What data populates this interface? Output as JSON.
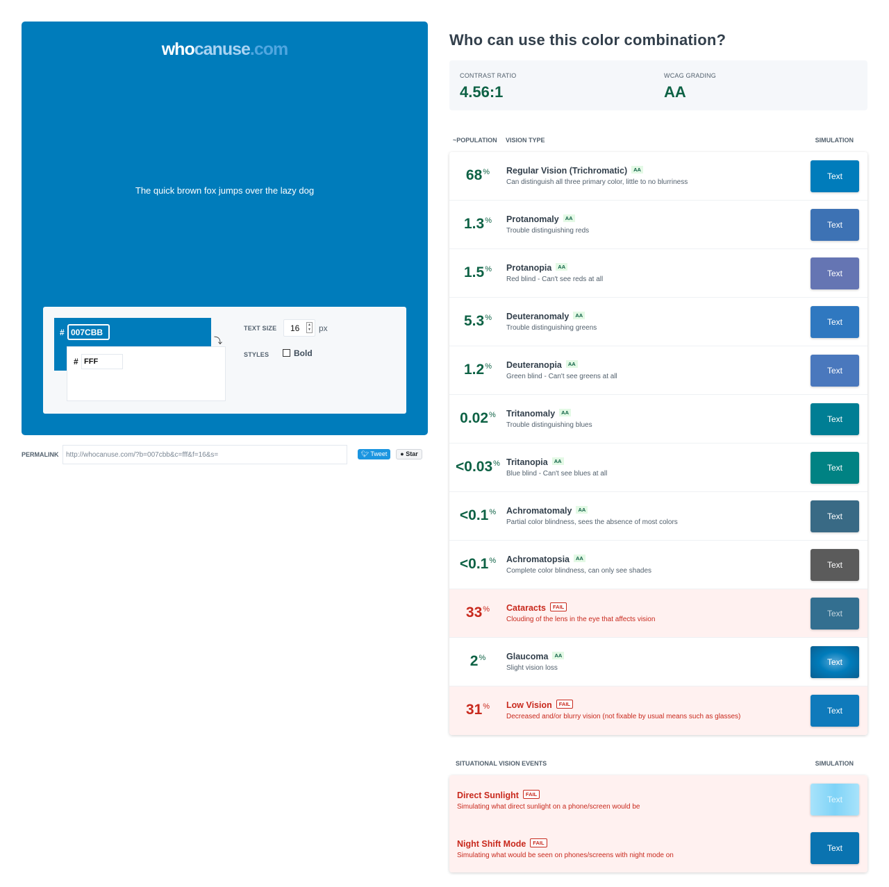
{
  "logo": {
    "who": "who",
    "canuse": "canuse",
    "dotcom": ".com"
  },
  "preview": {
    "sample_text": "The quick brown fox jumps over the lazy dog",
    "background": "#007CBB",
    "foreground": "#FFFFFF"
  },
  "controls": {
    "bg_hash": "#",
    "bg_value": "007CBB",
    "fg_hash": "#",
    "fg_value": "FFF",
    "swap_icon": "⤵",
    "text_size_label": "TEXT SIZE",
    "text_size_value": "16",
    "text_size_unit": "px",
    "styles_label": "STYLES",
    "bold_label": "Bold"
  },
  "permalink": {
    "label": "PERMALINK",
    "value": "http://whocanuse.com/?b=007cbb&c=fff&f=16&s=",
    "tweet_label": "Tweet",
    "star_label": "Star"
  },
  "results": {
    "title": "Who can use this color combination?",
    "contrast_label": "CONTRAST RATIO",
    "contrast_value": "4.56:1",
    "wcag_label": "WCAG GRADING",
    "wcag_value": "AA",
    "col_population": "~POPULATION",
    "col_vision": "VISION TYPE",
    "col_simulation": "SIMULATION",
    "rows": [
      {
        "pct": "68",
        "name": "Regular Vision (Trichromatic)",
        "badge": "AA",
        "desc": "Can distinguish all three primary color, little to no blurriness",
        "sim": "Text",
        "status": "pass",
        "sim_bg": "#007cbb"
      },
      {
        "pct": "1.3",
        "name": "Protanomaly",
        "badge": "AA",
        "desc": "Trouble distinguishing reds",
        "sim": "Text",
        "status": "pass",
        "sim_bg": "#3d72b4"
      },
      {
        "pct": "1.5",
        "name": "Protanopia",
        "badge": "AA",
        "desc": "Red blind - Can't see reds at all",
        "sim": "Text",
        "status": "pass",
        "sim_bg": "#6575b3"
      },
      {
        "pct": "5.3",
        "name": "Deuteranomaly",
        "badge": "AA",
        "desc": "Trouble distinguishing greens",
        "sim": "Text",
        "status": "pass",
        "sim_bg": "#2f78c0"
      },
      {
        "pct": "1.2",
        "name": "Deuteranopia",
        "badge": "AA",
        "desc": "Green blind - Can't see greens at all",
        "sim": "Text",
        "status": "pass",
        "sim_bg": "#4a78bd"
      },
      {
        "pct": "0.02",
        "name": "Tritanomaly",
        "badge": "AA",
        "desc": "Trouble distinguishing blues",
        "sim": "Text",
        "status": "pass",
        "sim_bg": "#007e94"
      },
      {
        "pct": "<0.03",
        "name": "Tritanopia",
        "badge": "AA",
        "desc": "Blue blind - Can't see blues at all",
        "sim": "Text",
        "status": "pass",
        "sim_bg": "#008283"
      },
      {
        "pct": "<0.1",
        "name": "Achromatomaly",
        "badge": "AA",
        "desc": "Partial color blindness, sees the absence of most colors",
        "sim": "Text",
        "status": "pass",
        "sim_bg": "#396a85"
      },
      {
        "pct": "<0.1",
        "name": "Achromatopsia",
        "badge": "AA",
        "desc": "Complete color blindness, can only see shades",
        "sim": "Text",
        "status": "pass",
        "sim_bg": "#5b5b5b"
      },
      {
        "pct": "33",
        "name": "Cataracts",
        "badge": "FAIL",
        "desc": "Clouding of the lens in the eye that affects vision",
        "sim": "Text",
        "status": "fail",
        "sim_bg": "#336f90"
      },
      {
        "pct": "2",
        "name": "Glaucoma",
        "badge": "AA",
        "desc": "Slight vision loss",
        "sim": "Text",
        "status": "pass",
        "sim_bg": "#007cbb"
      },
      {
        "pct": "31",
        "name": "Low Vision",
        "badge": "FAIL",
        "desc": "Decreased and/or blurry vision (not fixable by usual means such as glasses)",
        "sim": "Text",
        "status": "fail",
        "sim_bg": "#0f7abb"
      }
    ],
    "percent_sign": "%",
    "situational_label": "SITUATIONAL VISION EVENTS",
    "situational_sim_label": "SIMULATION",
    "situational": [
      {
        "name": "Direct Sunlight",
        "badge": "FAIL",
        "desc": "Simulating what direct sunlight on a phone/screen would be",
        "sim": "Text",
        "status": "fail",
        "sim_bg": "#7fd0f5"
      },
      {
        "name": "Night Shift Mode",
        "badge": "FAIL",
        "desc": "Simulating what would be seen on phones/screens with night mode on",
        "sim": "Text",
        "status": "fail",
        "sim_bg": "#0a73b0"
      }
    ]
  }
}
